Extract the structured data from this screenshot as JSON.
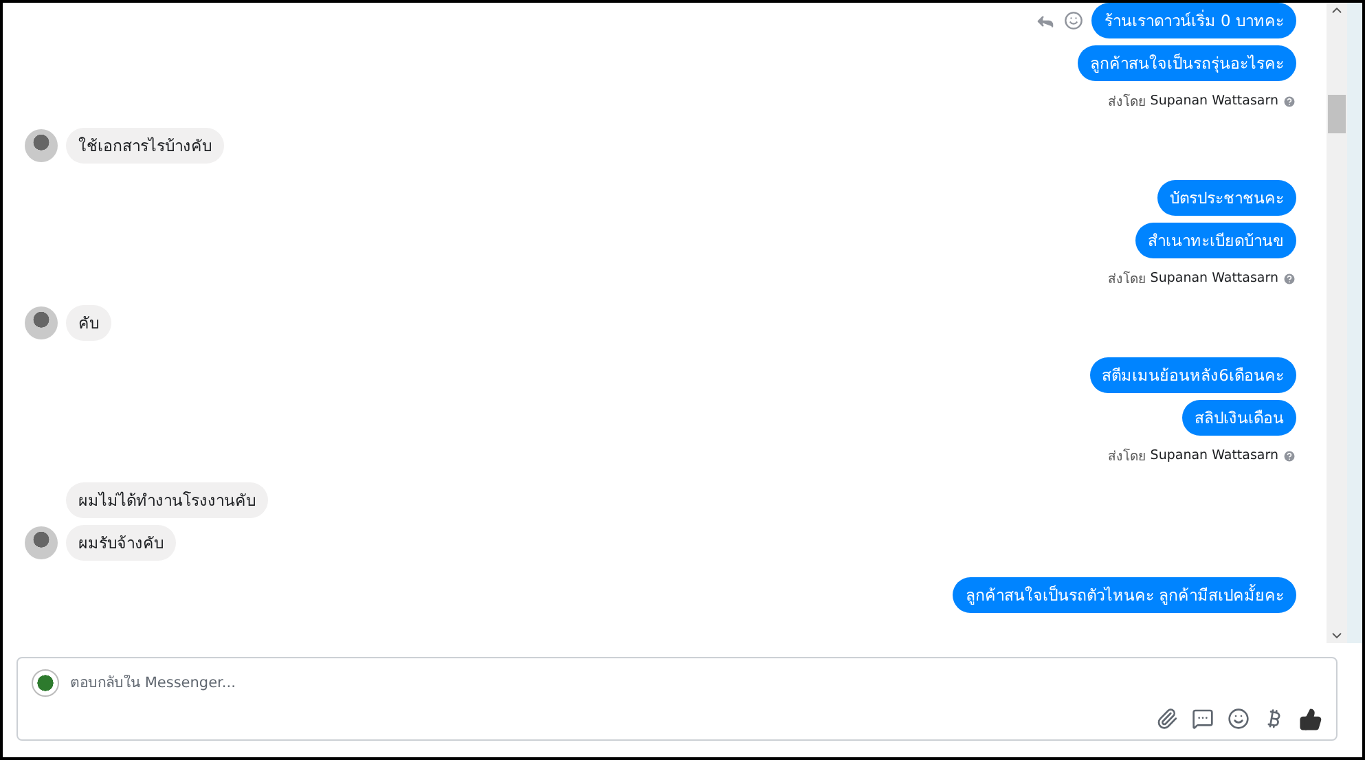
{
  "conversation": [
    {
      "kind": "out",
      "messages": [
        {
          "text": "ร้านเราดาวน์เริ่ม 0 บาทคะ",
          "actions_shown": true
        },
        {
          "text": "ลูกค้าสนใจเป็นรถรุ่นอะไรคะ",
          "actions_shown": false
        }
      ],
      "sent_by_label": "ส่งโดย",
      "sender": "Supanan Wattasarn"
    },
    {
      "kind": "in",
      "messages": [
        {
          "text": "ใช้เอกสารไรบ้างคับ",
          "actions_shown": false
        }
      ]
    },
    {
      "kind": "out",
      "messages": [
        {
          "text": "บัตรประชาชนคะ",
          "actions_shown": false
        },
        {
          "text": "สำเนาทะเบียดบ้านข",
          "actions_shown": false
        }
      ],
      "sent_by_label": "ส่งโดย",
      "sender": "Supanan Wattasarn"
    },
    {
      "kind": "in",
      "messages": [
        {
          "text": "คับ",
          "actions_shown": false
        }
      ]
    },
    {
      "kind": "out",
      "messages": [
        {
          "text": "สตีมเมนย้อนหลัง6เดือนคะ",
          "actions_shown": false
        },
        {
          "text": "สลิปเงินเดือน",
          "actions_shown": false
        }
      ],
      "sent_by_label": "ส่งโดย",
      "sender": "Supanan Wattasarn"
    },
    {
      "kind": "in",
      "messages": [
        {
          "text": "ผมไม่ได้ทำงานโรงงานคับ",
          "actions_shown": false
        },
        {
          "text": "ผมรับจ้างคับ",
          "actions_shown": false
        }
      ]
    },
    {
      "kind": "out",
      "messages": [
        {
          "text": "ลูกค้าสนใจเป็นรถตัวไหนคะ ลูกค้ามีสเปคมั้ยคะ",
          "actions_shown": false
        }
      ]
    }
  ],
  "composer": {
    "placeholder": "ตอบกลับใน Messenger..."
  }
}
